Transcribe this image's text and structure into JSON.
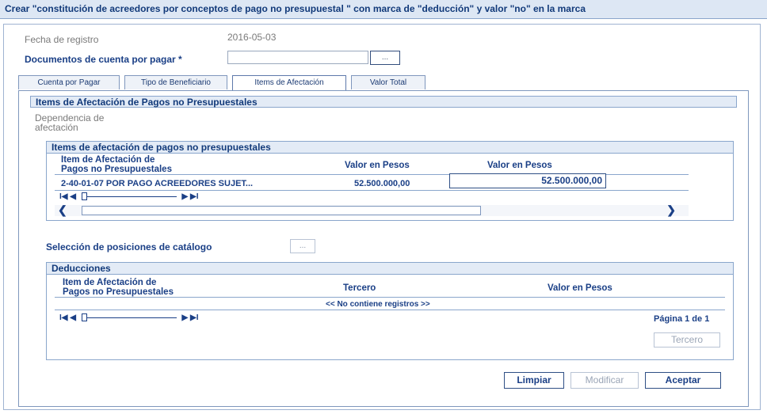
{
  "window": {
    "title": "Crear \"constitución de acreedores por conceptos de pago no presupuestal \" con marca de \"deducción\" y valor \"no\" en la marca"
  },
  "form": {
    "fecha_label": "Fecha de registro",
    "fecha_value": "2016-05-03",
    "documentos_label": "Documentos de cuenta por pagar *",
    "documentos_value": "",
    "dots": "..."
  },
  "tabs": [
    {
      "label": "Cuenta por Pagar"
    },
    {
      "label": "Tipo de Beneficiario"
    },
    {
      "label": "Items de Afectación",
      "active": true
    },
    {
      "label": "Valor Total"
    }
  ],
  "panel": {
    "title": "Items de Afectación de Pagos no Presupuestales",
    "dependencia_label_1": "Dependencia de",
    "dependencia_label_2": "afectación"
  },
  "items_grid": {
    "title": "Items de afectación de pagos no presupuestales",
    "col1_line1": "Item de Afectación de",
    "col1_line2": "Pagos no Presupuestales",
    "col2": "Valor en Pesos",
    "col3": "Valor en Pesos",
    "rows": [
      {
        "item": "2-40-01-07 POR PAGO ACREEDORES SUJET...",
        "valor": "52.500.000,00",
        "valor_input": "52.500.000,00"
      }
    ]
  },
  "catalogo": {
    "label": "Selección de posiciones de catálogo",
    "dots": "..."
  },
  "deducciones": {
    "title": "Deducciones",
    "col1_line1": "Item de Afectación de",
    "col1_line2": "Pagos no Presupuestales",
    "col2": "Tercero",
    "col3": "Valor en Pesos",
    "empty_text": "<< No contiene registros >>",
    "pagina": "Página 1 de 1",
    "tercero_button": "Tercero"
  },
  "pager": {
    "first": "I◀",
    "prev": "◀",
    "next": "▶",
    "last": "▶I"
  },
  "actions": {
    "limpiar": "Limpiar",
    "modificar": "Modificar",
    "aceptar": "Aceptar"
  }
}
